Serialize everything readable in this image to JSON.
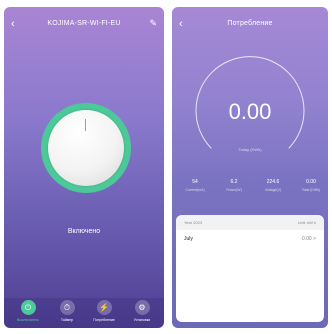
{
  "control": {
    "back_icon": "back-arrow-icon",
    "device_name": "KOJIMA-SR-WI-FI-EU",
    "edit_icon": "pencil-icon",
    "state_text": "Включено",
    "nav": [
      {
        "icon": "power-icon",
        "label": "Выключатель"
      },
      {
        "icon": "timer-icon",
        "label": "Таймер"
      },
      {
        "icon": "lightning-icon",
        "label": "Потребление"
      },
      {
        "icon": "settings-icon",
        "label": "Установки"
      }
    ],
    "accent": "#4cc998"
  },
  "consumption": {
    "back_icon": "back-arrow-icon",
    "title": "Потребление",
    "today_value": "0.00",
    "today_label": "Today (KWh)",
    "stats": [
      {
        "value": "54",
        "label": "Current(mA)"
      },
      {
        "value": "6.2",
        "label": "Power(W)"
      },
      {
        "value": "224.6",
        "label": "Voltage(V)"
      },
      {
        "value": "0.00",
        "label": "Total (KWh)"
      }
    ],
    "card": {
      "year": "Year 2023",
      "unit": "Unit: kW.h",
      "month": "July",
      "month_value": "0.00 >"
    }
  }
}
